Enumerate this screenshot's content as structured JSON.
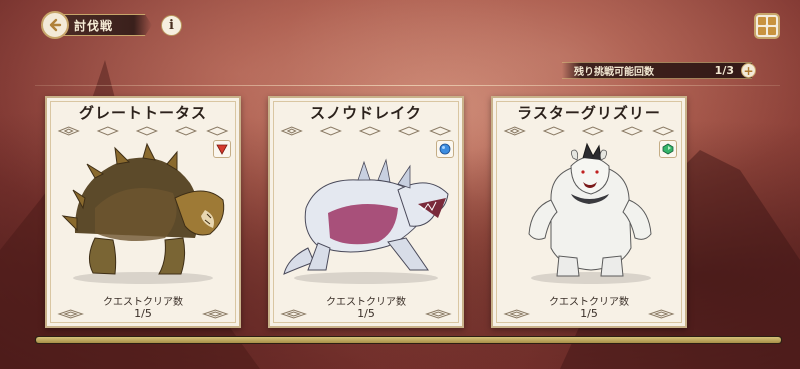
{
  "header": {
    "title": "討伐戦",
    "back_icon": "arrow-left-icon",
    "info_icon": "info-icon",
    "info_glyph": "i",
    "menu_icon": "grid-menu-icon"
  },
  "attempts": {
    "label": "残り挑戦可能回数",
    "value": "1/3",
    "plus_glyph": "+"
  },
  "cards": [
    {
      "name": "グレートトータス",
      "element": "fire",
      "element_color": "#d63b2e",
      "clear_label": "クエストクリア数",
      "clear_value": "1/5",
      "art": "tortoise-monster"
    },
    {
      "name": "スノウドレイク",
      "element": "water",
      "element_color": "#3d8de0",
      "clear_label": "クエストクリア数",
      "clear_value": "1/5",
      "art": "drake-monster"
    },
    {
      "name": "ラスターグリズリー",
      "element": "wind",
      "element_color": "#36b46a",
      "clear_label": "クエストクリア数",
      "clear_value": "1/5",
      "art": "grizzly-monster"
    }
  ],
  "scroll_progress": 1.0
}
